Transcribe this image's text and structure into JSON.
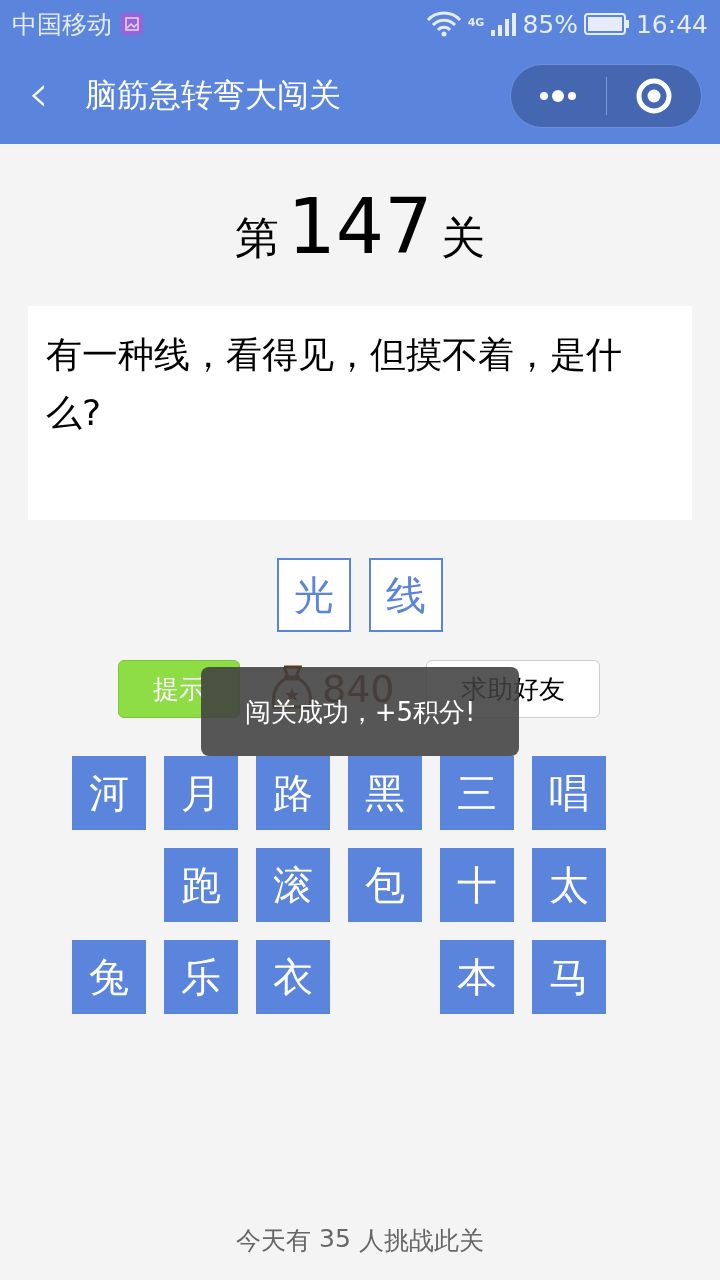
{
  "status_bar": {
    "carrier": "中国移动",
    "network": "4G",
    "battery": "85%",
    "time": "16:44"
  },
  "nav": {
    "back": "‹",
    "title": "脑筋急转弯大闯关"
  },
  "level": {
    "prefix": "第",
    "number": "147",
    "suffix": "关"
  },
  "question": "有一种线，看得见，但摸不着，是什么?",
  "answers": [
    "光",
    "线"
  ],
  "actions": {
    "hint": "提示",
    "coins": "840",
    "help": "求助好友"
  },
  "tiles": [
    {
      "kind": "char",
      "text": "河"
    },
    {
      "kind": "char",
      "text": "月"
    },
    {
      "kind": "char",
      "text": "路"
    },
    {
      "kind": "char",
      "text": "黑"
    },
    {
      "kind": "char",
      "text": "三"
    },
    {
      "kind": "char",
      "text": "唱"
    },
    {
      "kind": "blank"
    },
    {
      "kind": "char",
      "text": "跑"
    },
    {
      "kind": "char",
      "text": "滚"
    },
    {
      "kind": "char",
      "text": "包"
    },
    {
      "kind": "char",
      "text": "十"
    },
    {
      "kind": "char",
      "text": "太"
    },
    {
      "kind": "char",
      "text": "兔"
    },
    {
      "kind": "char",
      "text": "乐"
    },
    {
      "kind": "char",
      "text": "衣"
    },
    {
      "kind": "blank"
    },
    {
      "kind": "char",
      "text": "本"
    },
    {
      "kind": "char",
      "text": "马"
    }
  ],
  "toast": "闯关成功，+5积分!",
  "footer": {
    "before": "今天有",
    "count": "35",
    "after": "人挑战此关"
  }
}
